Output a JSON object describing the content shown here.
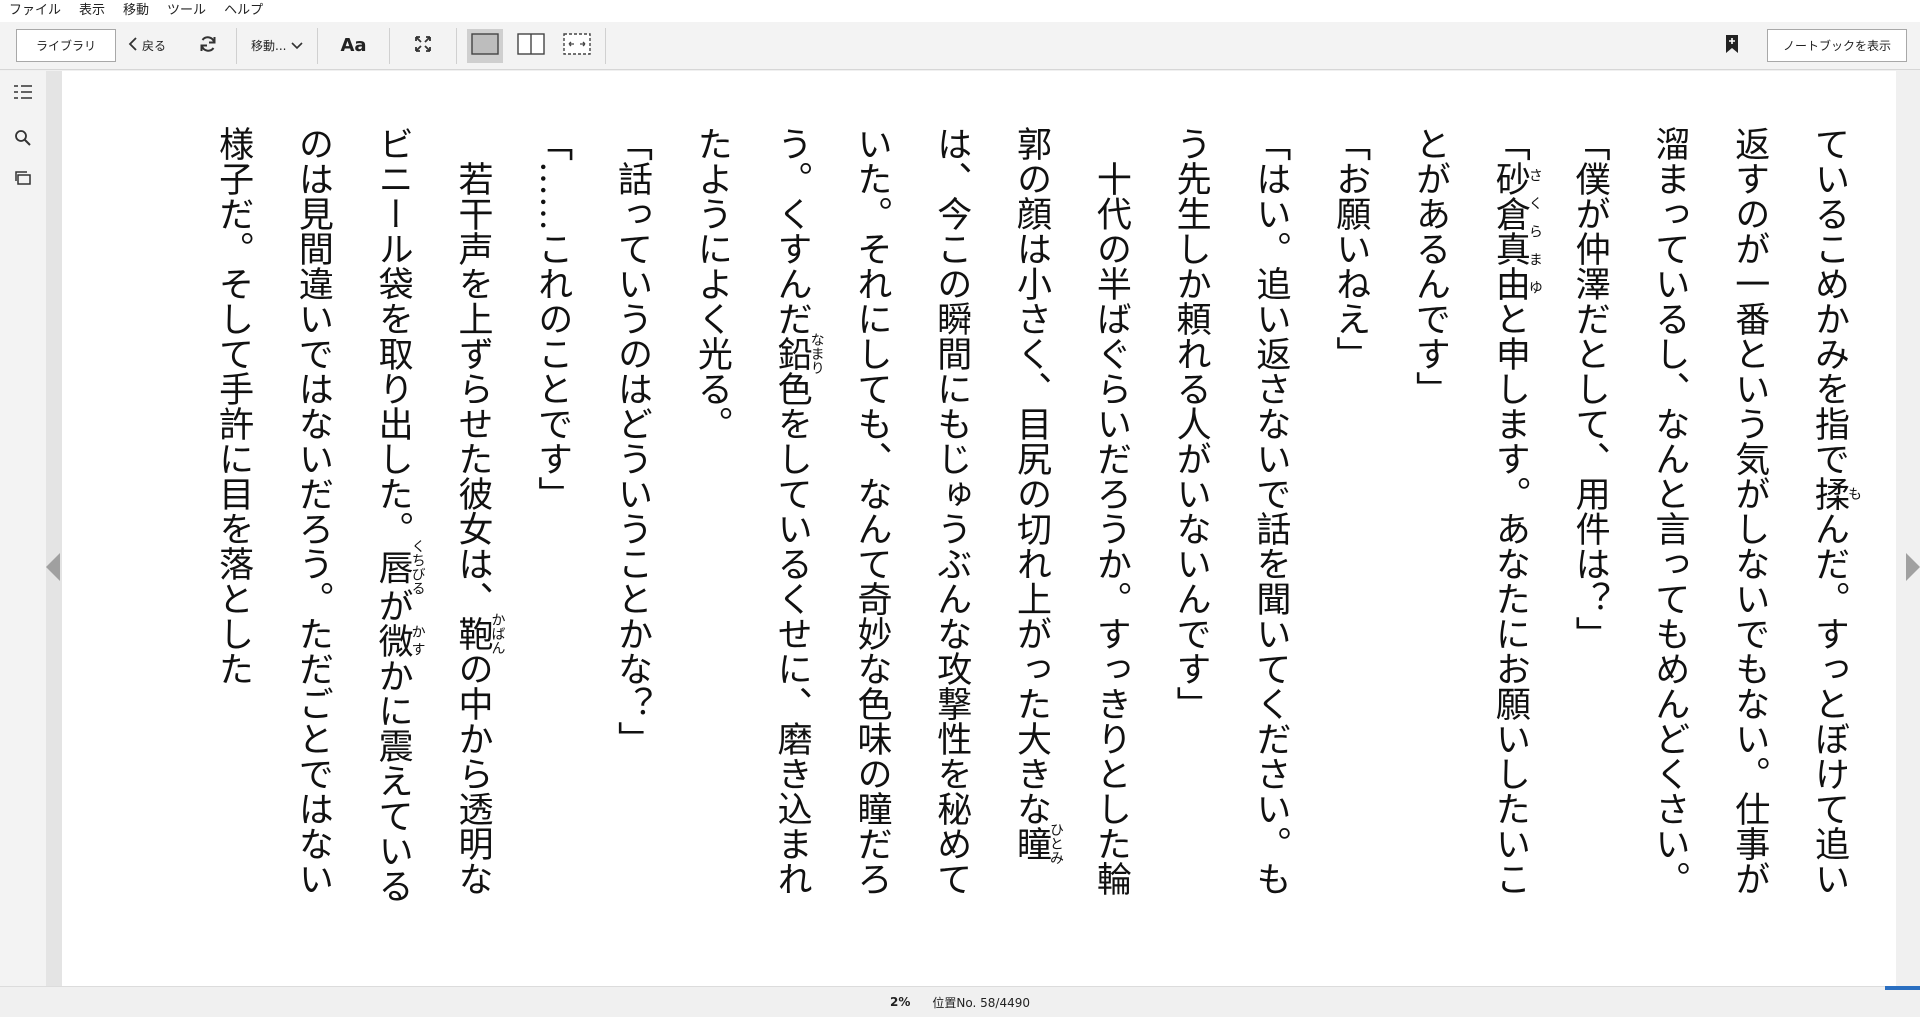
{
  "menu": [
    "ファイル",
    "表示",
    "移動",
    "ツール",
    "ヘルプ"
  ],
  "toolbar": {
    "library_label": "ライブラリ",
    "back_label": "戻る",
    "goto_label": "移動...",
    "font_label": "Aa",
    "notebook_label": "ノートブックを表示"
  },
  "sidebar_icons": [
    "table-of-contents-icon",
    "search-icon",
    "flashcards-icon"
  ],
  "lines": [
    {
      "segs": [
        {
          "t": "ているこめかみを指で"
        },
        {
          "b": "揉",
          "r": "も"
        },
        {
          "t": "んだ。すっとぼけて追い返すのが一番という気がしないでもない。仕事が溜まっているし、なんと言ってもめんどくさい。"
        }
      ]
    },
    {
      "segs": [
        {
          "t": "「僕が仲澤だとして、用件は？」"
        }
      ]
    },
    {
      "segs": [
        {
          "t": "「"
        },
        {
          "b": "砂倉真由",
          "r": "さくらまゆ"
        },
        {
          "t": "と申します。あなたにお願いしたいことがあるんです」"
        }
      ]
    },
    {
      "segs": [
        {
          "t": "「お願いねえ」"
        }
      ]
    },
    {
      "segs": [
        {
          "t": "「はい。追い返さないで話を聞いてください。もう先生しか頼れる人がいないんです」"
        }
      ]
    },
    {
      "indent": true,
      "segs": [
        {
          "t": "十代の半ばぐらいだろうか。すっきりとした輪郭の顔は小さく、目尻の切れ上がった大きな"
        },
        {
          "b": "瞳",
          "r": "ひとみ"
        },
        {
          "t": "は、今この瞬間にもじゅうぶんな攻撃性を秘めていた。それにしても、なんて奇妙な色味の瞳だろう。くすんだ"
        },
        {
          "b": "鉛",
          "r": "なまり"
        },
        {
          "t": "色をしているくせに、磨き込まれたようによく光る。"
        }
      ]
    },
    {
      "segs": [
        {
          "t": "「話っていうのはどういうことかな？」"
        }
      ]
    },
    {
      "segs": [
        {
          "t": "「……これのことです」"
        }
      ]
    },
    {
      "indent": true,
      "segs": [
        {
          "t": "若干声を上ずらせた彼女は、"
        },
        {
          "b": "鞄",
          "r": "かばん"
        },
        {
          "t": "の中から透明なビニール袋を取り出した。"
        },
        {
          "b": "唇",
          "r": "くちびる"
        },
        {
          "t": "が"
        },
        {
          "b": "微",
          "r": "かす"
        },
        {
          "t": "かに震えているのは見間違いではないだろう。ただごとではない様子だ。そして手許に目を落とした"
        }
      ]
    }
  ],
  "status": {
    "percent": "2%",
    "location": "位置No. 58/4490",
    "progress_fraction": 0.02
  }
}
